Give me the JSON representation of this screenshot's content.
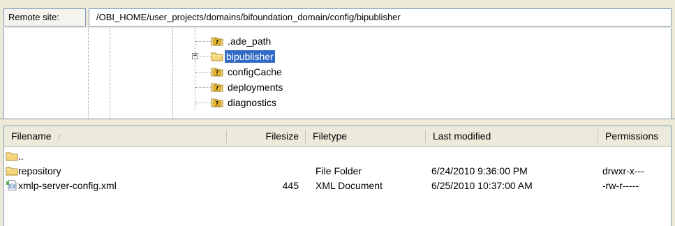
{
  "remote_site": {
    "label": "Remote site:",
    "path": "/OBI_HOME/user_projects/domains/bifoundation_domain/config/bipublisher"
  },
  "tree": {
    "items": [
      {
        "label": ".ade_path",
        "icon": "question-folder-icon",
        "selected": false,
        "expander": ""
      },
      {
        "label": "bipublisher",
        "icon": "folder-icon",
        "selected": true,
        "expander": "+"
      },
      {
        "label": "configCache",
        "icon": "question-folder-icon",
        "selected": false,
        "expander": ""
      },
      {
        "label": "deployments",
        "icon": "question-folder-icon",
        "selected": false,
        "expander": ""
      },
      {
        "label": "diagnostics",
        "icon": "question-folder-icon",
        "selected": false,
        "expander": ""
      }
    ]
  },
  "file_list": {
    "columns": {
      "filename": "Filename",
      "sort_indicator": "/",
      "filesize": "Filesize",
      "filetype": "Filetype",
      "last_modified": "Last modified",
      "permissions": "Permissions"
    },
    "rows": [
      {
        "name": "..",
        "icon": "folder-icon",
        "size": "",
        "type": "",
        "modified": "",
        "permissions": ""
      },
      {
        "name": "repository",
        "icon": "folder-icon",
        "size": "",
        "type": "File Folder",
        "modified": "6/24/2010 9:36:00 PM",
        "permissions": "drwxr-x---"
      },
      {
        "name": "xmlp-server-config.xml",
        "icon": "xml-file-icon",
        "size": "445",
        "type": "XML Document",
        "modified": "6/25/2010 10:37:00 AM",
        "permissions": "-rw-r-----"
      }
    ]
  },
  "colors": {
    "selection": "#316ac5",
    "folder": "#f5d67a",
    "border": "#7f9db9"
  }
}
